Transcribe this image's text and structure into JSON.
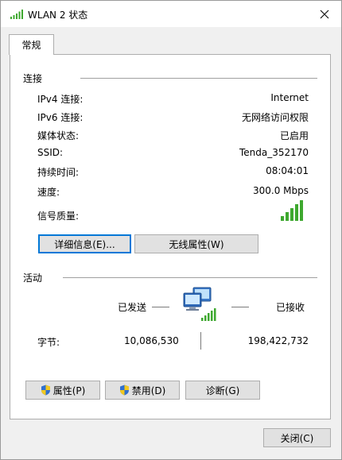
{
  "window": {
    "title": "WLAN 2 状态"
  },
  "tabs": [
    {
      "label": "常规"
    }
  ],
  "connection": {
    "section_label": "连接",
    "rows": [
      {
        "label": "IPv4 连接:",
        "value": "Internet"
      },
      {
        "label": "IPv6 连接:",
        "value": "无网络访问权限"
      },
      {
        "label": "媒体状态:",
        "value": "已启用"
      },
      {
        "label": "SSID:",
        "value": "Tenda_352170"
      },
      {
        "label": "持续时间:",
        "value": "08:04:01"
      },
      {
        "label": "速度:",
        "value": "300.0 Mbps"
      },
      {
        "label": "信号质量:",
        "signal_bars": 5,
        "signal_max": 5
      }
    ],
    "details_button": "详细信息(E)...",
    "wireless_props_button": "无线属性(W)"
  },
  "activity": {
    "section_label": "活动",
    "sent_label": "已发送",
    "received_label": "已接收",
    "bytes_label": "字节:",
    "bytes_sent": "10,086,530",
    "bytes_received": "198,422,732",
    "properties_button": "属性(P)",
    "disable_button": "禁用(D)",
    "diagnose_button": "诊断(G)"
  },
  "footer": {
    "close_button": "关闭(C)"
  },
  "colors": {
    "signal_green": "#3ea82f",
    "focus_blue": "#0078d7",
    "shield_blue": "#2f6fcf",
    "shield_yellow": "#f2c81f"
  }
}
